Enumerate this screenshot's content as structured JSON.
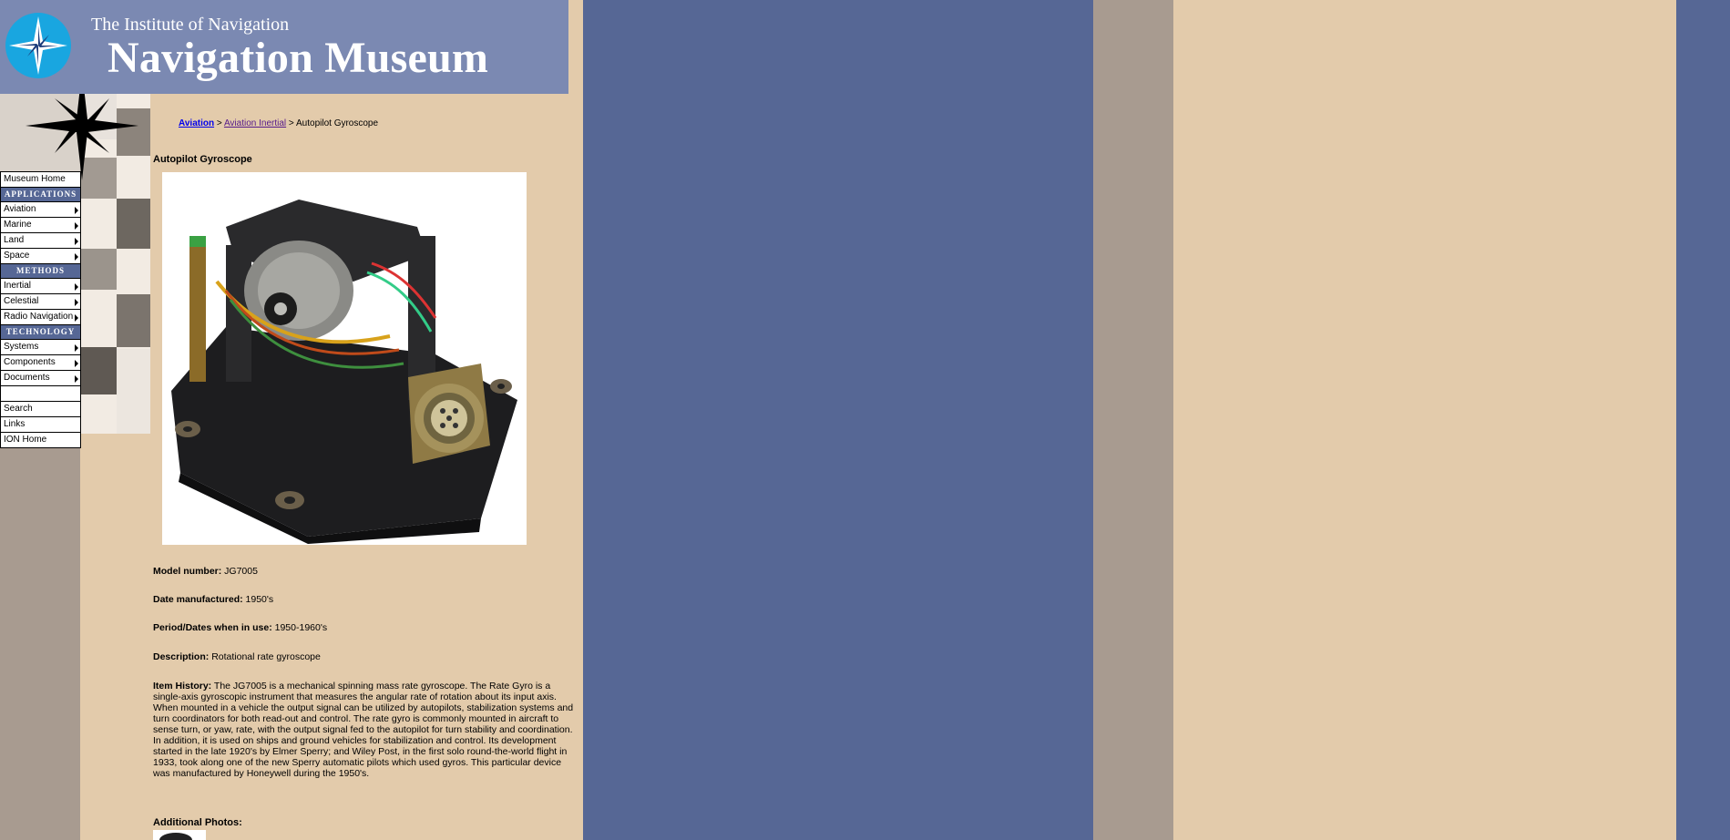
{
  "header": {
    "org": "The Institute of Navigation",
    "title": "Navigation Museum"
  },
  "menu": {
    "museum_home": "Museum Home",
    "applications_header": "APPLICATIONS",
    "applications": [
      "Aviation",
      "Marine",
      "Land",
      "Space"
    ],
    "methods_header": "METHODS",
    "methods": [
      "Inertial",
      "Celestial",
      "Radio Navigation"
    ],
    "technology_header": "TECHNOLOGY",
    "technology": [
      "Systems",
      "Components",
      "Documents"
    ],
    "search": "Search",
    "links": "Links",
    "ion_home": "ION Home"
  },
  "breadcrumb": {
    "link1": "Aviation",
    "sep": ">",
    "link2": "Aviation Inertial",
    "current": "Autopilot Gyroscope"
  },
  "item": {
    "title": "Autopilot Gyroscope",
    "model_label": "Model number:",
    "model_value": "JG7005",
    "date_label": "Date manufactured:",
    "date_value": "1950's",
    "period_label": "Period/Dates when in use:",
    "period_value": "1950-1960's",
    "desc_label": "Description:",
    "desc_value": "Rotational rate gyroscope",
    "history_label": "Item History:",
    "history_value": "The JG7005 is a mechanical spinning mass rate gyroscope. The Rate Gyro is a single-axis gyroscopic instrument that measures the angular rate of rotation about its input axis. When mounted in a vehicle the output signal can be utilized by autopilots, stabilization systems and turn coordinators for both read-out and control. The rate gyro is commonly mounted in aircraft to sense turn, or yaw, rate, with the output signal fed to the autopilot for turn stability and coordination. In addition, it is used on ships and ground vehicles for stabilization and control. Its development started in the late 1920's by Elmer Sperry; and Wiley Post, in the first solo round-the-world flight in 1933, took along one of the new Sperry automatic pilots which used gyros. This particular device was manufactured by Honeywell during the 1950's.",
    "additional_photos": "Additional Photos:"
  },
  "colors": {
    "header_blue": "#7b89b2",
    "nav_blue": "#566795",
    "tan": "#e3cbab",
    "gray": "#a89b90"
  }
}
